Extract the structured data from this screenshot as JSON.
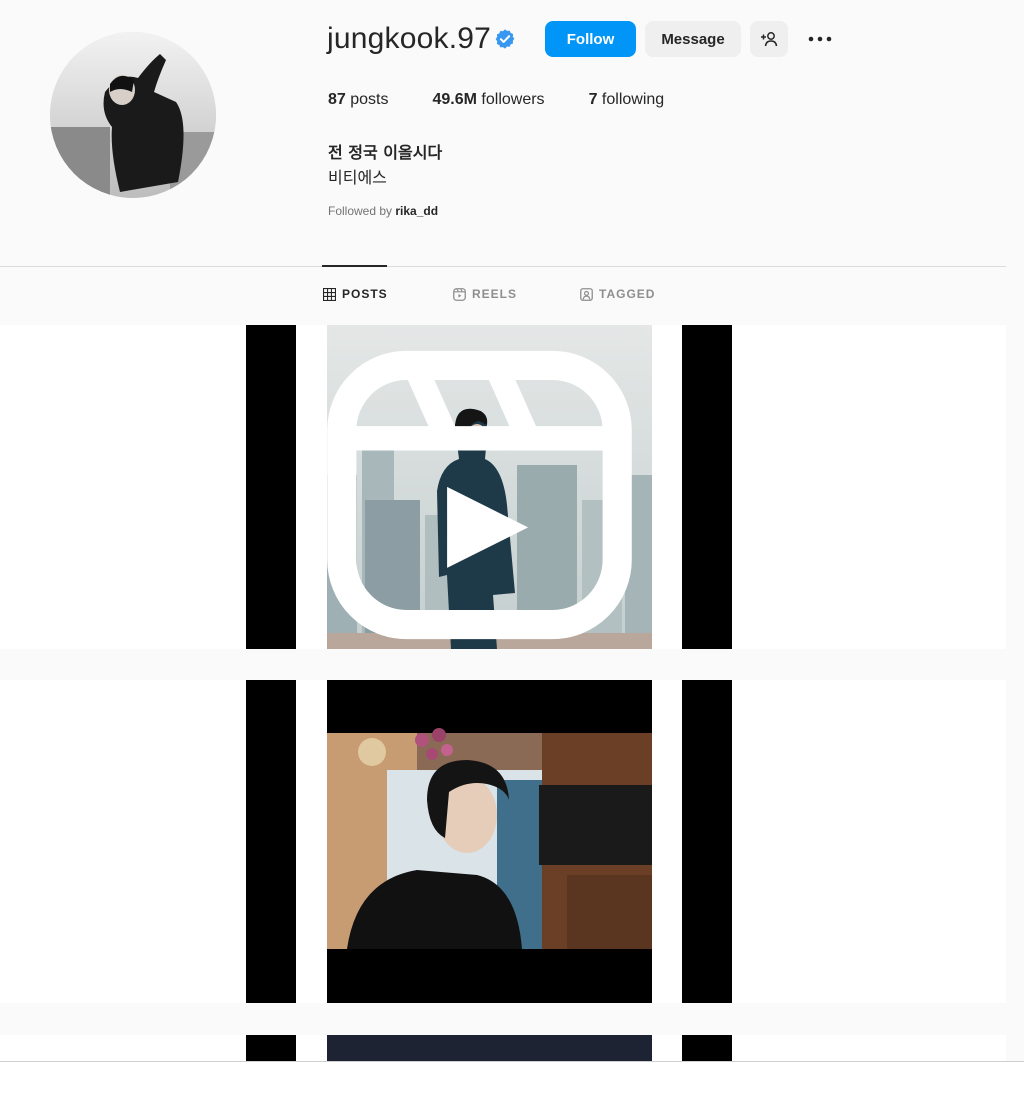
{
  "profile": {
    "username": "jungkook.97",
    "verified": true,
    "follow_label": "Follow",
    "message_label": "Message",
    "stats": {
      "posts_count": "87",
      "posts_label": "posts",
      "followers_count": "49.6M",
      "followers_label": "followers",
      "following_count": "7",
      "following_label": "following"
    },
    "full_name": "전 정국 이올시다",
    "bio": "비티에스",
    "followed_by_prefix": "Followed by",
    "followed_by_user": "rika_dd"
  },
  "tabs": [
    {
      "label": "POSTS",
      "icon": "grid-icon",
      "active": true
    },
    {
      "label": "REELS",
      "icon": "reels-icon",
      "active": false
    },
    {
      "label": "TAGGED",
      "icon": "tagged-icon",
      "active": false
    }
  ],
  "colors": {
    "accent": "#0095f6",
    "verified": "#3897f0"
  }
}
